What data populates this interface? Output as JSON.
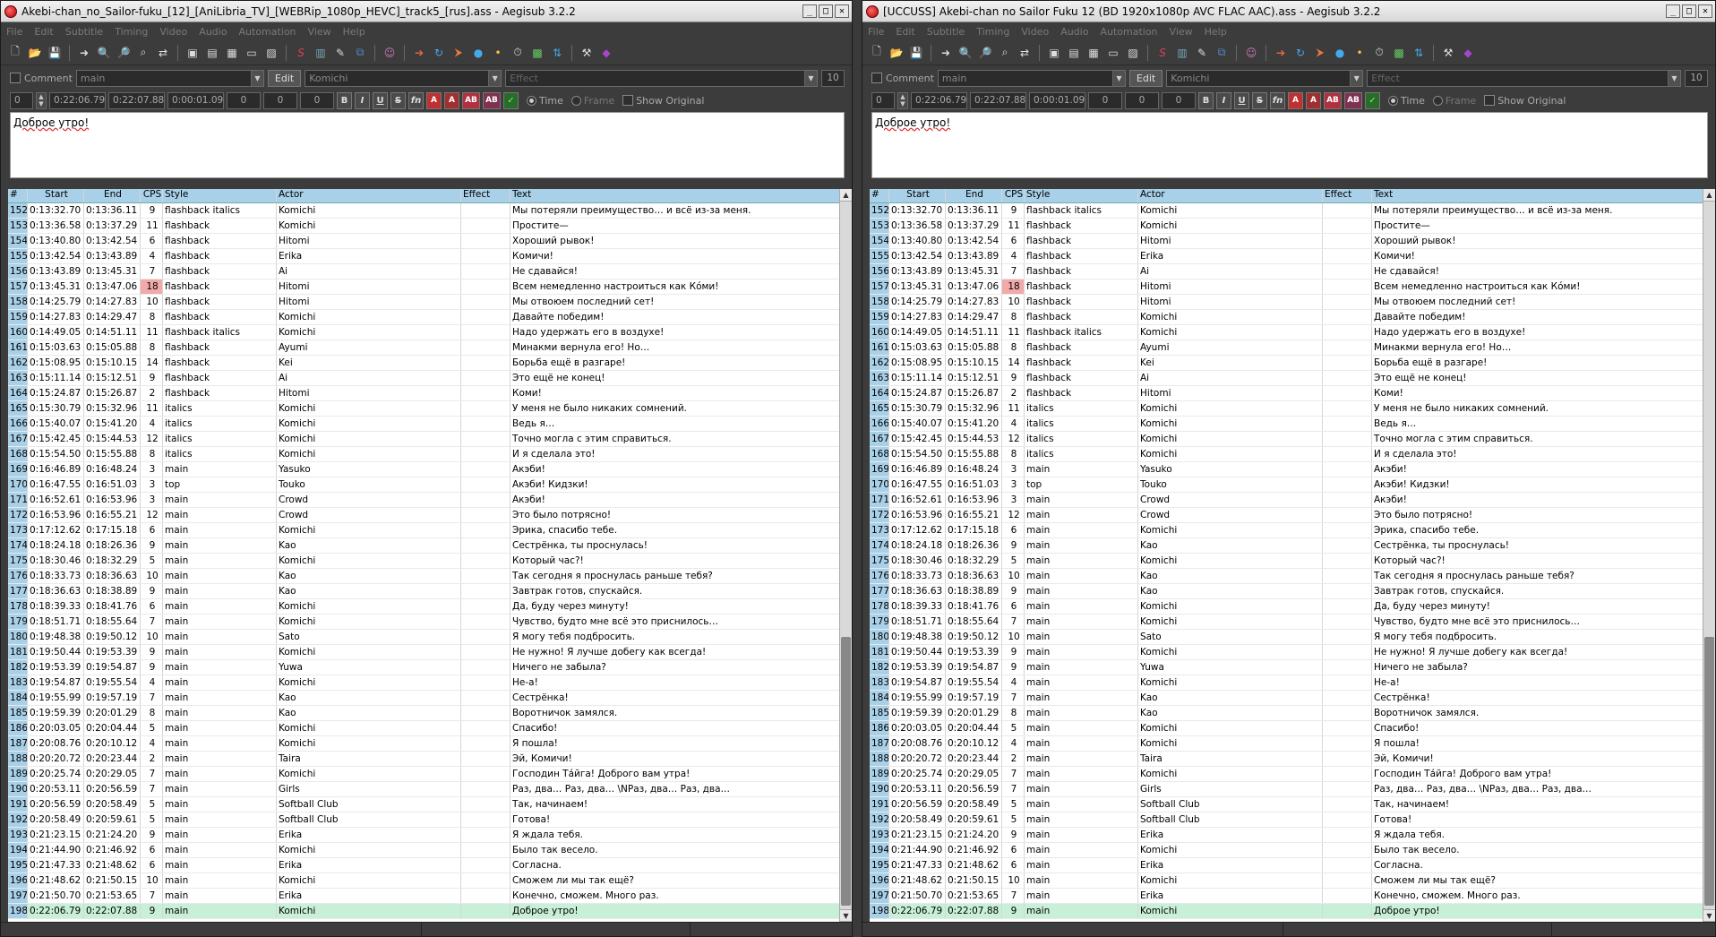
{
  "windows": [
    {
      "id": "left",
      "title": "Akebi-chan_no_Sailor-fuku_[12]_[AniLibria_TV]_[WEBRip_1080p_HEVC]_track5_[rus].ass - Aegisub 3.2.2",
      "window_controls": {
        "minimize": "_",
        "maximize": "□",
        "close": "✕"
      },
      "menu": [
        "File",
        "Edit",
        "Subtitle",
        "Timing",
        "Video",
        "Audio",
        "Automation",
        "View",
        "Help"
      ],
      "edit": {
        "comment_label": "Comment",
        "style": "main",
        "edit_button": "Edit",
        "actor": "Komichi",
        "effect_placeholder": "Effect",
        "layer_right": "10",
        "layer": "0",
        "start": "0:22:06.79",
        "end": "0:22:07.88",
        "duration": "0:00:01.09",
        "margin_l": "0",
        "margin_r": "0",
        "margin_v": "0",
        "time_label": "Time",
        "frame_label": "Frame",
        "show_original_label": "Show Original",
        "text": "Доброе утро!"
      }
    },
    {
      "id": "right",
      "title": "[UCCUSS] Akebi-chan no Sailor Fuku 12 (BD 1920x1080p AVC FLAC AAC).ass - Aegisub 3.2.2",
      "window_controls": {
        "minimize": "_",
        "maximize": "□",
        "close": "✕"
      },
      "menu": [
        "File",
        "Edit",
        "Subtitle",
        "Timing",
        "Video",
        "Audio",
        "Automation",
        "View",
        "Help"
      ],
      "edit": {
        "comment_label": "Comment",
        "style": "main",
        "edit_button": "Edit",
        "actor": "Komichi",
        "effect_placeholder": "Effect",
        "layer_right": "10",
        "layer": "0",
        "start": "0:22:06.79",
        "end": "0:22:07.88",
        "duration": "0:00:01.09",
        "margin_l": "0",
        "margin_r": "0",
        "margin_v": "0",
        "time_label": "Time",
        "frame_label": "Frame",
        "show_original_label": "Show Original",
        "text": "Доброе утро!"
      }
    }
  ],
  "grid": {
    "columns": [
      "#",
      "Start",
      "End",
      "CPS",
      "Style",
      "Actor",
      "Effect",
      "Text"
    ],
    "rows": [
      [
        "152",
        "0:13:32.70",
        "0:13:36.11",
        "9",
        "flashback italics",
        "Komichi",
        "",
        "Мы потеряли преимущество… и всё из-за меня."
      ],
      [
        "153",
        "0:13:36.58",
        "0:13:37.29",
        "11",
        "flashback",
        "Komichi",
        "",
        "Простите—"
      ],
      [
        "154",
        "0:13:40.80",
        "0:13:42.54",
        "6",
        "flashback",
        "Hitomi",
        "",
        "Хороший рывок!"
      ],
      [
        "155",
        "0:13:42.54",
        "0:13:43.89",
        "4",
        "flashback",
        "Erika",
        "",
        "Комичи!"
      ],
      [
        "156",
        "0:13:43.89",
        "0:13:45.31",
        "7",
        "flashback",
        "Ai",
        "",
        "Не сдавайся!"
      ],
      [
        "157",
        "0:13:45.31",
        "0:13:47.06",
        "18",
        "flashback",
        "Hitomi",
        "",
        "Всем немедленно настроиться как Кóми!"
      ],
      [
        "158",
        "0:14:25.79",
        "0:14:27.83",
        "10",
        "flashback",
        "Hitomi",
        "",
        "Мы отвоюем последний сет!"
      ],
      [
        "159",
        "0:14:27.83",
        "0:14:29.47",
        "8",
        "flashback",
        "Komichi",
        "",
        "Давайте победим!"
      ],
      [
        "160",
        "0:14:49.05",
        "0:14:51.11",
        "11",
        "flashback italics",
        "Komichi",
        "",
        "Надо удержать его в воздухе!"
      ],
      [
        "161",
        "0:15:03.63",
        "0:15:05.88",
        "8",
        "flashback",
        "Ayumi",
        "",
        "Минакми вернула его! Но…"
      ],
      [
        "162",
        "0:15:08.95",
        "0:15:10.15",
        "14",
        "flashback",
        "Kei",
        "",
        "Борьба ещё в разгаре!"
      ],
      [
        "163",
        "0:15:11.14",
        "0:15:12.51",
        "9",
        "flashback",
        "Ai",
        "",
        "Это ещё не конец!"
      ],
      [
        "164",
        "0:15:24.87",
        "0:15:26.87",
        "2",
        "flashback",
        "Hitomi",
        "",
        "Коми!"
      ],
      [
        "165",
        "0:15:30.79",
        "0:15:32.96",
        "11",
        "italics",
        "Komichi",
        "",
        "У меня не было никаких сомнений."
      ],
      [
        "166",
        "0:15:40.07",
        "0:15:41.20",
        "4",
        "italics",
        "Komichi",
        "",
        "Ведь я…"
      ],
      [
        "167",
        "0:15:42.45",
        "0:15:44.53",
        "12",
        "italics",
        "Komichi",
        "",
        "Точно могла с этим справиться."
      ],
      [
        "168",
        "0:15:54.50",
        "0:15:55.88",
        "8",
        "italics",
        "Komichi",
        "",
        "И я сделала это!"
      ],
      [
        "169",
        "0:16:46.89",
        "0:16:48.24",
        "3",
        "main",
        "Yasuko",
        "",
        "Акэби!"
      ],
      [
        "170",
        "0:16:47.55",
        "0:16:51.03",
        "3",
        "top",
        "Touko",
        "",
        "Акэби! Кидзки!"
      ],
      [
        "171",
        "0:16:52.61",
        "0:16:53.96",
        "3",
        "main",
        "Crowd",
        "",
        "Акэби!"
      ],
      [
        "172",
        "0:16:53.96",
        "0:16:55.21",
        "12",
        "main",
        "Crowd",
        "",
        "Это было потрясно!"
      ],
      [
        "173",
        "0:17:12.62",
        "0:17:15.18",
        "6",
        "main",
        "Komichi",
        "",
        "Эрика, спасибо тебе."
      ],
      [
        "174",
        "0:18:24.18",
        "0:18:26.36",
        "9",
        "main",
        "Kao",
        "",
        "Сестрёнка, ты проснулась!"
      ],
      [
        "175",
        "0:18:30.46",
        "0:18:32.29",
        "5",
        "main",
        "Komichi",
        "",
        "Который час?!"
      ],
      [
        "176",
        "0:18:33.73",
        "0:18:36.63",
        "10",
        "main",
        "Kao",
        "",
        "Так сегодня я проснулась раньше тебя?"
      ],
      [
        "177",
        "0:18:36.63",
        "0:18:38.89",
        "9",
        "main",
        "Kao",
        "",
        "Завтрак готов, спускайся."
      ],
      [
        "178",
        "0:18:39.33",
        "0:18:41.76",
        "6",
        "main",
        "Komichi",
        "",
        "Да, буду через минуту!"
      ],
      [
        "179",
        "0:18:51.71",
        "0:18:55.64",
        "7",
        "main",
        "Komichi",
        "",
        "Чувство, будто мне всё это приснилось…"
      ],
      [
        "180",
        "0:19:48.38",
        "0:19:50.12",
        "10",
        "main",
        "Sato",
        "",
        "Я могу тебя подбросить."
      ],
      [
        "181",
        "0:19:50.44",
        "0:19:53.39",
        "9",
        "main",
        "Komichi",
        "",
        "Не нужно! Я лучше добегу как всегда!"
      ],
      [
        "182",
        "0:19:53.39",
        "0:19:54.87",
        "9",
        "main",
        "Yuwa",
        "",
        "Ничего не забыла?"
      ],
      [
        "183",
        "0:19:54.87",
        "0:19:55.54",
        "4",
        "main",
        "Komichi",
        "",
        "Не-а!"
      ],
      [
        "184",
        "0:19:55.99",
        "0:19:57.19",
        "7",
        "main",
        "Kao",
        "",
        "Сестрёнка!"
      ],
      [
        "185",
        "0:19:59.39",
        "0:20:01.29",
        "8",
        "main",
        "Kao",
        "",
        "Воротничок замялся."
      ],
      [
        "186",
        "0:20:03.05",
        "0:20:04.44",
        "5",
        "main",
        "Komichi",
        "",
        "Спасибо!"
      ],
      [
        "187",
        "0:20:08.76",
        "0:20:10.12",
        "4",
        "main",
        "Komichi",
        "",
        "Я пошла!"
      ],
      [
        "188",
        "0:20:20.72",
        "0:20:23.44",
        "2",
        "main",
        "Taira",
        "",
        "Эй, Комичи!"
      ],
      [
        "189",
        "0:20:25.74",
        "0:20:29.05",
        "7",
        "main",
        "Komichi",
        "",
        "Господин Тáйга! Доброго вам утра!"
      ],
      [
        "190",
        "0:20:53.11",
        "0:20:56.59",
        "7",
        "main",
        "Girls",
        "",
        "Раз, два… Раз, два… \\NРаз, два… Раз, два…"
      ],
      [
        "191",
        "0:20:56.59",
        "0:20:58.49",
        "5",
        "main",
        "Softball Club",
        "",
        "Так, начинаем!"
      ],
      [
        "192",
        "0:20:58.49",
        "0:20:59.61",
        "5",
        "main",
        "Softball Club",
        "",
        "Готова!"
      ],
      [
        "193",
        "0:21:23.15",
        "0:21:24.20",
        "9",
        "main",
        "Erika",
        "",
        "Я ждала тебя."
      ],
      [
        "194",
        "0:21:44.90",
        "0:21:46.92",
        "6",
        "main",
        "Komichi",
        "",
        "Было так весело."
      ],
      [
        "195",
        "0:21:47.33",
        "0:21:48.62",
        "6",
        "main",
        "Erika",
        "",
        "Согласна."
      ],
      [
        "196",
        "0:21:48.62",
        "0:21:50.15",
        "10",
        "main",
        "Komichi",
        "",
        "Сможем ли мы так ещё?"
      ],
      [
        "197",
        "0:21:50.70",
        "0:21:53.65",
        "7",
        "main",
        "Erika",
        "",
        "Конечно, сможем. Много раз."
      ],
      [
        "198",
        "0:22:06.79",
        "0:22:07.88",
        "9",
        "main",
        "Komichi",
        "",
        "Доброе утро!"
      ]
    ],
    "active_row": "198",
    "highlight_cps_row": "157"
  },
  "colors": {
    "header_bg": "#a8d0e8",
    "active_row_bg": "#c8f0d8",
    "cps_warning_bg": "#f2a9a9",
    "window_bg": "#3c3c3c"
  }
}
